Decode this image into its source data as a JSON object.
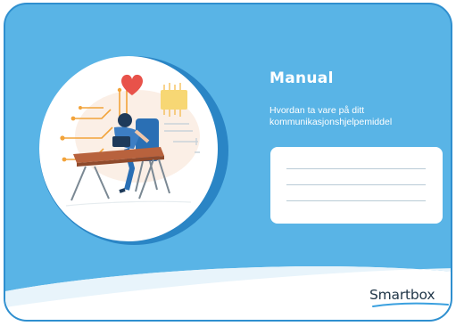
{
  "cover": {
    "title": "Manual",
    "subtitle": "Hvordan ta vare på ditt kommunikasjonshjelpemiddel",
    "brand": "Smartbox"
  },
  "colors": {
    "background_blue": "#59b4e6",
    "dark_blue": "#2a85c5",
    "heart_red": "#e8524a",
    "circuit_orange": "#f2a33a",
    "brand_text": "#22384a"
  },
  "icons": [
    "heart-icon",
    "circuit-lines",
    "person-at-desk",
    "smartbox-swoosh"
  ]
}
